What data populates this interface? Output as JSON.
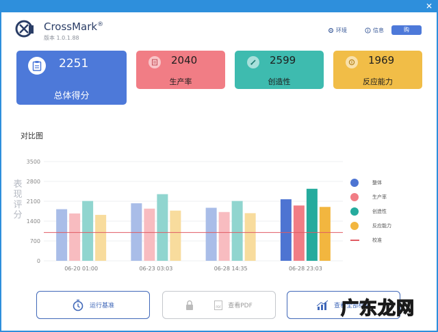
{
  "window": {
    "close_glyph": "✕"
  },
  "app": {
    "name": "CrossMark",
    "reg": "®",
    "version": "版本 1.0.1.88"
  },
  "header": {
    "env_label": "环境",
    "info_label": "信息",
    "buy_label": "购"
  },
  "cards": {
    "total": {
      "value": "2251",
      "label": "总体得分",
      "icon": "clipboard-icon"
    },
    "productivity": {
      "value": "2040",
      "label": "生产率",
      "icon": "document-icon"
    },
    "creativity": {
      "value": "2599",
      "label": "创造性",
      "icon": "brush-icon"
    },
    "responsiveness": {
      "value": "1969",
      "label": "反应能力",
      "icon": "coin-icon"
    }
  },
  "comparison": {
    "title": "对比图",
    "ylabel": "表现评分"
  },
  "chart_data": {
    "type": "bar",
    "ylim": [
      0,
      3500
    ],
    "yticks": [
      "0",
      "700",
      "1400",
      "2100",
      "2800",
      "3500"
    ],
    "categories": [
      "06-20 01:00",
      "06-23 03:03",
      "06-28 14:35",
      "06-28 23:03"
    ],
    "series": [
      {
        "name": "整体",
        "values": [
          1820,
          2030,
          1870,
          2170
        ]
      },
      {
        "name": "生产率",
        "values": [
          1670,
          1840,
          1720,
          1950
        ]
      },
      {
        "name": "创造性",
        "values": [
          2110,
          2350,
          2110,
          2540
        ]
      },
      {
        "name": "反应能力",
        "values": [
          1620,
          1770,
          1680,
          1900
        ]
      }
    ],
    "baseline": {
      "name": "校准",
      "value": 1000
    },
    "colors": {
      "full": [
        "#4d74d2",
        "#f17d85",
        "#25ab9d",
        "#f2b63f"
      ],
      "faded": [
        "#a9bde8",
        "#f8bcc0",
        "#90d5cf",
        "#f8dc9d"
      ],
      "baseline": "#e05a62"
    },
    "grid": true,
    "legend_position": "right"
  },
  "actions": {
    "run_label": "运行基准",
    "pdf_label": "查看PDF",
    "pdf_badge": "PDF",
    "more_label": "查看全部结果"
  },
  "watermark": {
    "text": "广东龙网"
  }
}
